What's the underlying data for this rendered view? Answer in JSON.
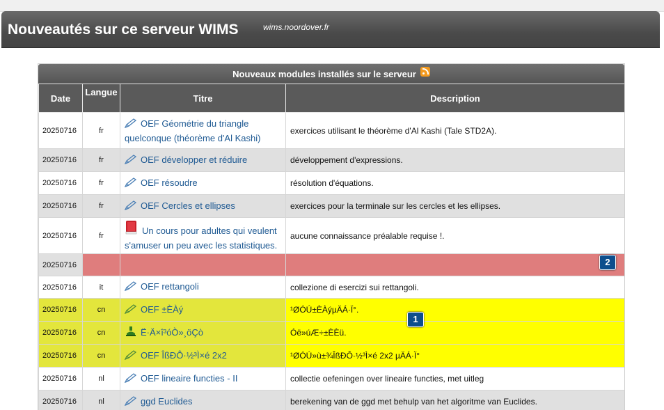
{
  "page": {
    "title": "Nouveautés sur ce serveur WIMS",
    "server": "wims.noordover.fr"
  },
  "table": {
    "caption": "Nouveaux modules installés sur le serveur",
    "headers": {
      "date": "Date",
      "lang": "Langue",
      "title": "Titre",
      "description": "Description"
    },
    "rows": [
      {
        "date": "20250716",
        "lang": "fr",
        "icon": "pencil-icon",
        "title": "OEF Géométrie du triangle quelconque (théorème d'Al Kashi)",
        "description": "exercices utilisant le théorème d'Al Kashi (Tale STD2A)."
      },
      {
        "date": "20250716",
        "lang": "fr",
        "icon": "pencil-icon",
        "title": "OEF développer et réduire",
        "description": "développement d'expressions."
      },
      {
        "date": "20250716",
        "lang": "fr",
        "icon": "pencil-icon",
        "title": "OEF résoudre",
        "description": "résolution d'équations."
      },
      {
        "date": "20250716",
        "lang": "fr",
        "icon": "pencil-icon",
        "title": "OEF Cercles et ellipses",
        "description": "exercices pour la terminale sur les cercles et les ellipses."
      },
      {
        "date": "20250716",
        "lang": "fr",
        "icon": "book-icon",
        "title": "Un cours pour adultes qui veulent s'amuser un peu avec les statistiques.",
        "description": "aucune connaissance préalable requise !."
      },
      {
        "date": "20250716",
        "lang": "",
        "icon": "",
        "title": "",
        "description": ""
      },
      {
        "date": "20250716",
        "lang": "it",
        "icon": "pencil-icon",
        "title": "OEF rettangoli",
        "description": "collezione di esercizi sui rettangoli."
      },
      {
        "date": "20250716",
        "lang": "cn",
        "icon": "pencil-icon",
        "title": "OEF ±ÈÀý",
        "description": "¹ØÓÚ±ÈÀýµÄÁ·Ï°."
      },
      {
        "date": "20250716",
        "lang": "cn",
        "icon": "stamp-icon",
        "title": "Ë·Ä×î³óÒ»¸öÇò",
        "description": "Óë»úÆ÷±ÈÈü."
      },
      {
        "date": "20250716",
        "lang": "cn",
        "icon": "pencil-icon",
        "title": "OEF ÎßÐÔ·½³Ì×é 2x2",
        "description": "¹ØÓÚ»ù±¾ÎßÐÔ·½³Ì×é 2x2 µÄÁ·Ï°"
      },
      {
        "date": "20250716",
        "lang": "nl",
        "icon": "pencil-icon",
        "title": "OEF lineaire functies - II",
        "description": "collectie oefeningen over lineaire functies, met uitleg"
      },
      {
        "date": "20250716",
        "lang": "nl",
        "icon": "pencil-icon",
        "title": "ggd Euclides",
        "description": "berekening van de ggd met behulp van het algoritme van Euclides."
      }
    ]
  },
  "badges": {
    "one": "1",
    "two": "2"
  },
  "colors": {
    "highlight_yellow": "#ffff00",
    "highlight_olive": "#e3e63c",
    "highlight_red": "#df7d7d",
    "link": "#1f5a93"
  }
}
